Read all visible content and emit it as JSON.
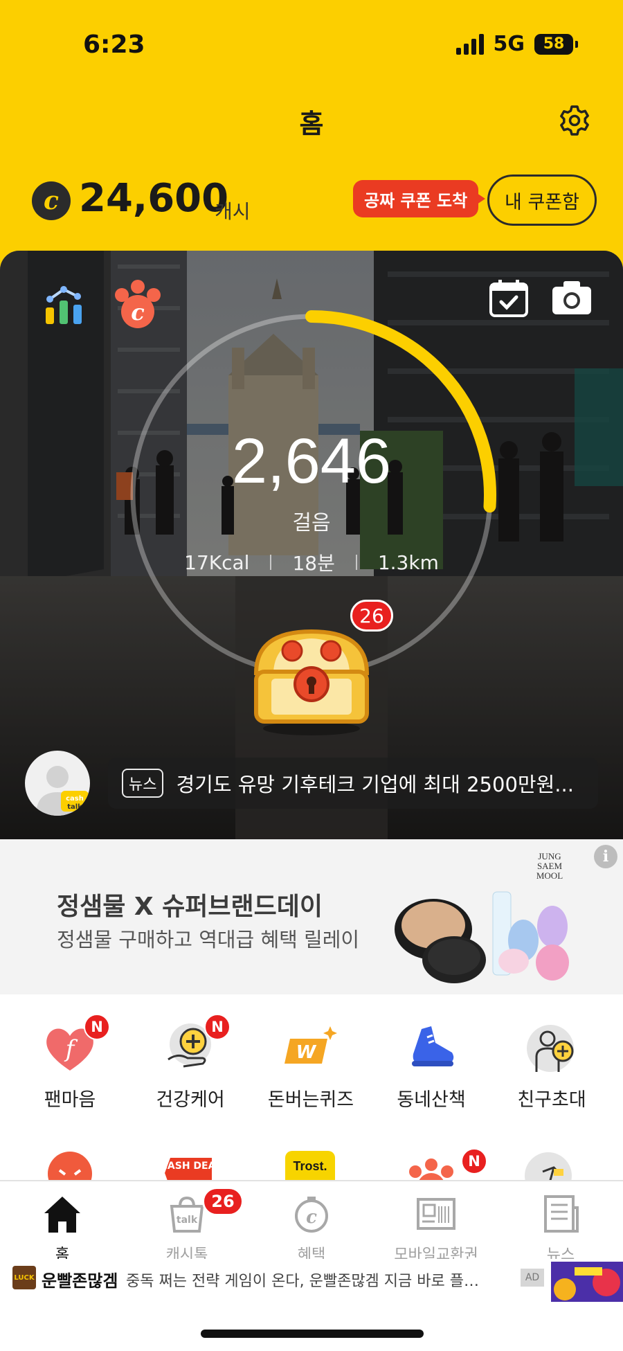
{
  "status_bar": {
    "time": "6:23",
    "network": "5G",
    "battery": "58"
  },
  "header": {
    "title": "홈"
  },
  "cash": {
    "amount": "24,600",
    "unit": "캐시",
    "coupon_tag": "공짜 쿠폰 도착",
    "coupon_button": "내 쿠폰함"
  },
  "hero": {
    "steps": "2,646",
    "steps_label": "걸음",
    "progress": 0.26,
    "metrics": {
      "kcal": "17Kcal",
      "minutes": "18분",
      "distance": "1.3km"
    },
    "chest_badge": "26",
    "avatar_badge": "cash talk",
    "news": {
      "tag": "뉴스",
      "text": "경기도 유망 기후테크 기업에 최대 2500만원..."
    }
  },
  "ad_banner": {
    "title": "정샘물 X 슈퍼브랜드데이",
    "subtitle": "정샘물 구매하고 역대급 혜택 릴레이",
    "brand": "JUNG SAEM MOOL",
    "info": "i"
  },
  "shortcuts": [
    {
      "label": "팬마음",
      "icon": "fan-heart-icon",
      "badge": "N"
    },
    {
      "label": "건강케어",
      "icon": "health-care-icon",
      "badge": "N"
    },
    {
      "label": "돈버는퀴즈",
      "icon": "money-quiz-icon",
      "badge": ""
    },
    {
      "label": "동네산책",
      "icon": "sneaker-icon",
      "badge": ""
    },
    {
      "label": "친구초대",
      "icon": "invite-friend-icon",
      "badge": ""
    }
  ],
  "shortcuts_row2": [
    {
      "icon": "cat-face-icon",
      "text": ""
    },
    {
      "icon": "cash-deal-icon",
      "text": "CASH DEAL"
    },
    {
      "icon": "trost-icon",
      "text": "Trost."
    },
    {
      "icon": "paw-icon",
      "badge": "N"
    },
    {
      "icon": "runner-icon"
    }
  ],
  "bottom_nav": [
    {
      "label": "홈",
      "icon": "home-icon",
      "active": true
    },
    {
      "label": "캐시톡",
      "icon": "talk-bag-icon",
      "badge": "26"
    },
    {
      "label": "혜택",
      "icon": "benefit-coin-icon"
    },
    {
      "label": "모바일교환권",
      "icon": "voucher-icon"
    },
    {
      "label": "뉴스",
      "icon": "news-icon"
    }
  ],
  "ticker": {
    "logo": "LUCK",
    "title": "운빨존많겜",
    "text": "중독 쩌는 전략 게임이 온다, 운빨존많겜 지금 바로 플…",
    "ad_label": "AD"
  },
  "colors": {
    "brand_yellow": "#fccf00",
    "alert_red": "#e8201f",
    "coupon_red": "#ea3b22"
  }
}
